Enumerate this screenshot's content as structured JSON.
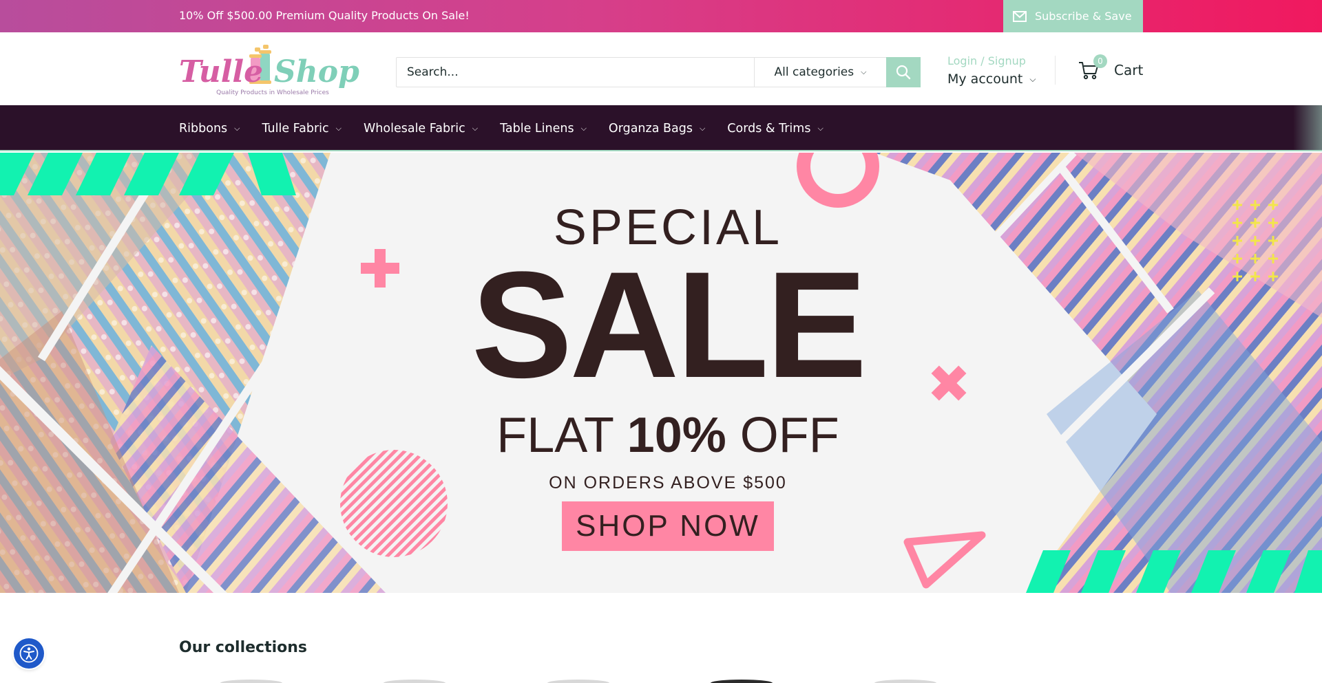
{
  "announcement": {
    "text": "10% Off $500.00 Premium Quality Products On Sale!",
    "subscribe_label": "Subscribe & Save",
    "subscribe_icon": "mail-icon"
  },
  "header": {
    "logo": {
      "word1": "Tulle",
      "word2": "Shop",
      "tagline": "Quality Products in Wholesale Prices"
    },
    "search": {
      "placeholder": "Search...",
      "category": "All categories"
    },
    "account": {
      "login_label": "Login / Signup",
      "account_label": "My account"
    },
    "cart": {
      "count": "0",
      "label": "Cart"
    }
  },
  "nav": {
    "items": [
      {
        "label": "Ribbons"
      },
      {
        "label": "Tulle Fabric"
      },
      {
        "label": "Wholesale Fabric"
      },
      {
        "label": "Table Linens"
      },
      {
        "label": "Organza Bags"
      },
      {
        "label": "Cords & Trims"
      }
    ]
  },
  "hero": {
    "line1": "SPECIAL",
    "line2": "SALE",
    "flat_prefix": "FLAT",
    "flat_amount": "10%",
    "flat_suffix": "OFF",
    "condition": "ON ORDERS ABOVE $500",
    "cta": "SHOP NOW"
  },
  "collections": {
    "title": "Our collections"
  },
  "colors": {
    "accent_mint": "#a3d8c1",
    "nav_bg": "#2b1129",
    "sale_pink": "#ff86a4",
    "banner_green": "#12f2b0",
    "topbar_gradient": [
      "#b84d9c",
      "#f0195f"
    ]
  }
}
